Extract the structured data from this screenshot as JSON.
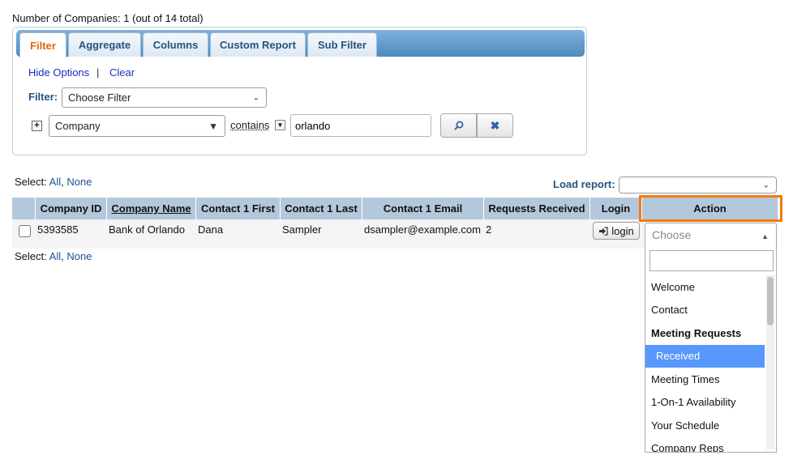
{
  "summary": {
    "count_text": "Number of Companies: 1 (out of 14 total)"
  },
  "tabs": [
    {
      "label": "Filter",
      "active": true
    },
    {
      "label": "Aggregate"
    },
    {
      "label": "Columns"
    },
    {
      "label": "Custom Report"
    },
    {
      "label": "Sub Filter"
    }
  ],
  "filter_panel": {
    "hide_options": "Hide Options",
    "separator": "|",
    "clear": "Clear",
    "filter_label": "Filter:",
    "choose_filter": "Choose Filter",
    "plus": "+",
    "field": "Company",
    "operator": "contains",
    "value": "orlando"
  },
  "select_links": {
    "prefix": "Select:",
    "all": "All",
    "none": "None"
  },
  "load_report": {
    "label": "Load report:",
    "value": ""
  },
  "table": {
    "headers": [
      "Company ID",
      "Company Name",
      "Contact 1 First",
      "Contact 1 Last",
      "Contact 1 Email",
      "Requests Received",
      "Login",
      "Action"
    ],
    "rows": [
      {
        "company_id": "5393585",
        "company_name": "Bank of Orlando",
        "first": "Dana",
        "last": "Sampler",
        "email": "dsampler@example.com",
        "requests": "2",
        "login_label": "login"
      }
    ]
  },
  "action_dropdown": {
    "placeholder": "Choose",
    "search_value": "",
    "items": [
      {
        "label": "Welcome",
        "kind": "option"
      },
      {
        "label": "Contact",
        "kind": "option"
      },
      {
        "label": "Meeting Requests",
        "kind": "group"
      },
      {
        "label": "Received",
        "kind": "sub",
        "selected": true
      },
      {
        "label": "Meeting Times",
        "kind": "option"
      },
      {
        "label": "1-On-1 Availability",
        "kind": "option"
      },
      {
        "label": "Your Schedule",
        "kind": "option"
      },
      {
        "label": "Company Reps",
        "kind": "option"
      }
    ]
  },
  "colors": {
    "accent": "#f07d0b",
    "tab_active": "#e0660f",
    "header_bg": "#b4c8dc",
    "selected": "#5897fb"
  },
  "icons": {
    "search": "magnifier-icon",
    "clear": "x-icon",
    "login": "sign-in-icon",
    "plus": "plus-icon"
  }
}
